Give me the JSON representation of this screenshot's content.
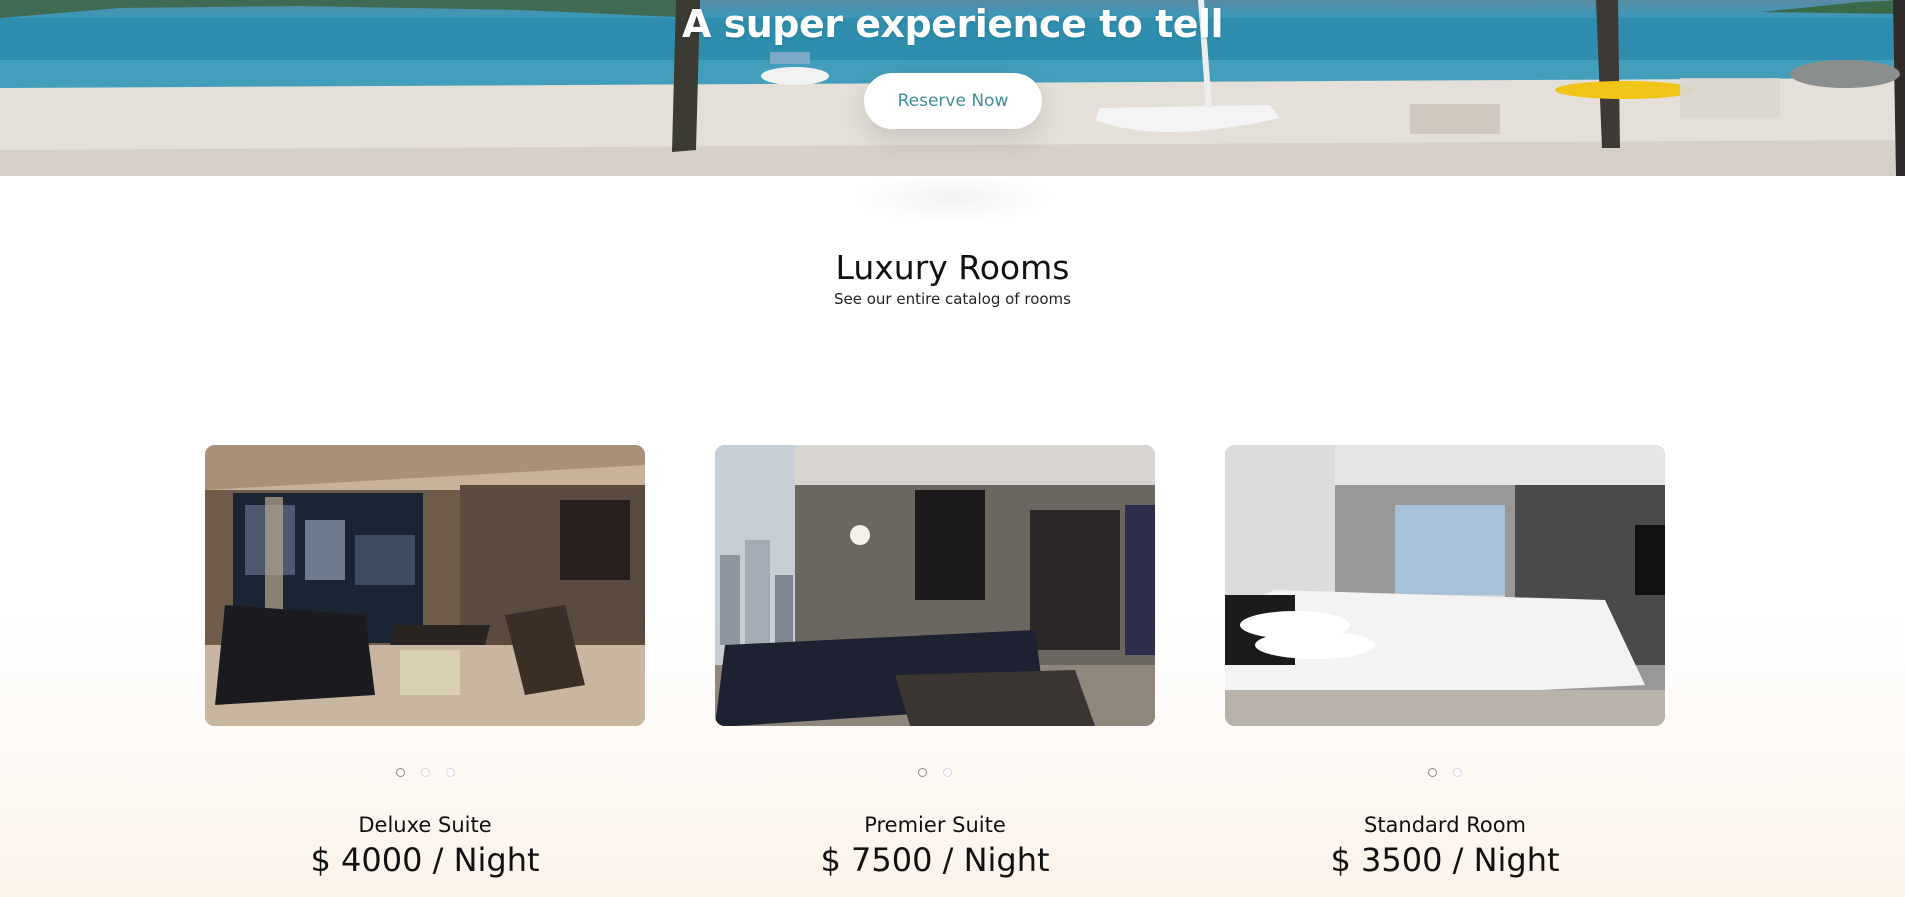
{
  "hero": {
    "title": "A super experience to tell",
    "button_label": "Reserve Now"
  },
  "section": {
    "title": "Luxury Rooms",
    "subtitle": "See our entire catalog of rooms"
  },
  "rooms": [
    {
      "name": "Deluxe Suite",
      "price": "$ 4000 / Night",
      "slides": 3,
      "active_slide": 1
    },
    {
      "name": "Premier Suite",
      "price": "$ 7500 / Night",
      "slides": 2,
      "active_slide": 1
    },
    {
      "name": "Standard Room",
      "price": "$ 3500 / Night",
      "slides": 2,
      "active_slide": 1
    }
  ],
  "colors": {
    "button_text": "#3d8f96",
    "sea": "#2d8fb0",
    "sand": "#e6e1da"
  }
}
